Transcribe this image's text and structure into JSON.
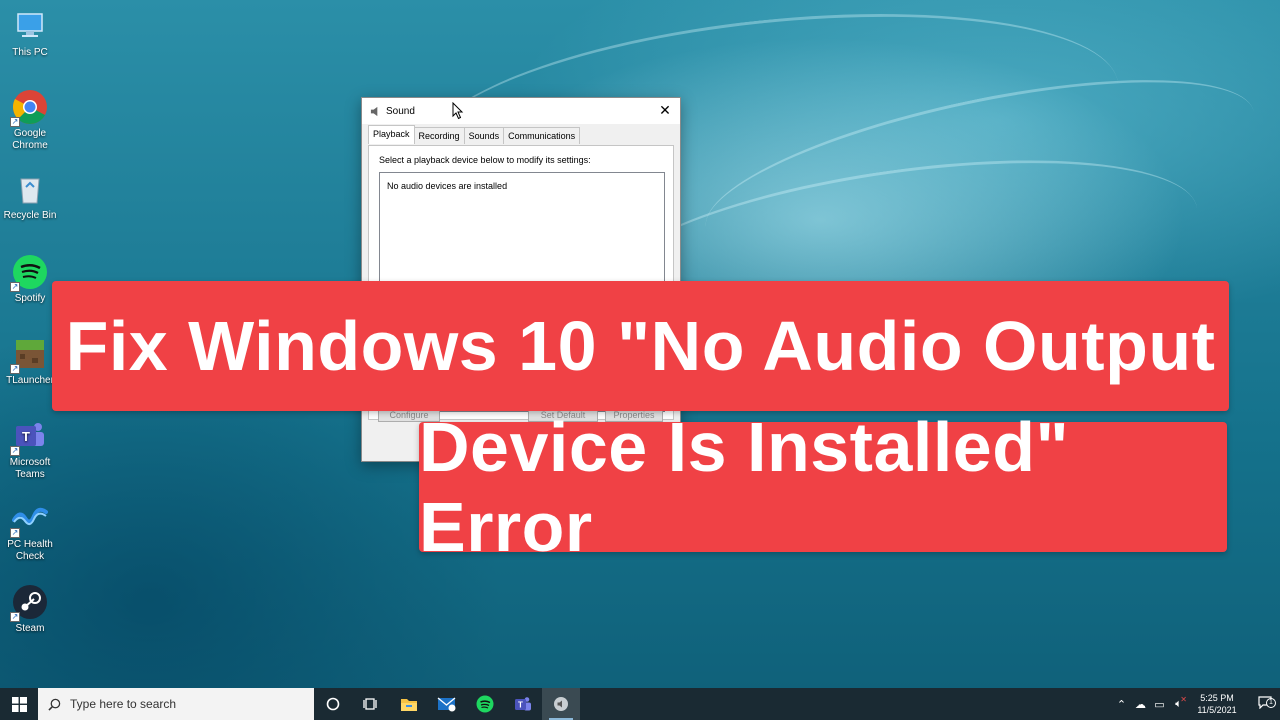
{
  "desktop": {
    "icons": [
      {
        "label": "This PC",
        "icon": "this-pc-icon"
      },
      {
        "label": "Google\nChrome",
        "icon": "chrome-icon"
      },
      {
        "label": "Recycle Bin",
        "icon": "recycle-bin-icon"
      },
      {
        "label": "Spotify",
        "icon": "spotify-icon"
      },
      {
        "label": "TLauncher",
        "icon": "tlauncher-icon"
      },
      {
        "label": "Microsoft\nTeams",
        "icon": "teams-icon"
      },
      {
        "label": "PC Health\nCheck",
        "icon": "pc-health-check-icon"
      },
      {
        "label": "Steam",
        "icon": "steam-icon"
      }
    ]
  },
  "dialog": {
    "title": "Sound",
    "tabs": [
      "Playback",
      "Recording",
      "Sounds",
      "Communications"
    ],
    "active_tab": "Playback",
    "instruction": "Select a playback device below to modify its settings:",
    "empty_message": "No audio devices are installed",
    "buttons": {
      "configure": "Configure",
      "set_default": "Set Default",
      "properties": "Properties"
    }
  },
  "banner": {
    "line1": "Fix Windows 10 \"No Audio Output",
    "line2": "Device Is Installed\" Error",
    "color": "#f04145"
  },
  "taskbar": {
    "search_placeholder": "Type here to search",
    "time": "5:25 PM",
    "date": "11/5/2021",
    "notification_count": "1"
  }
}
